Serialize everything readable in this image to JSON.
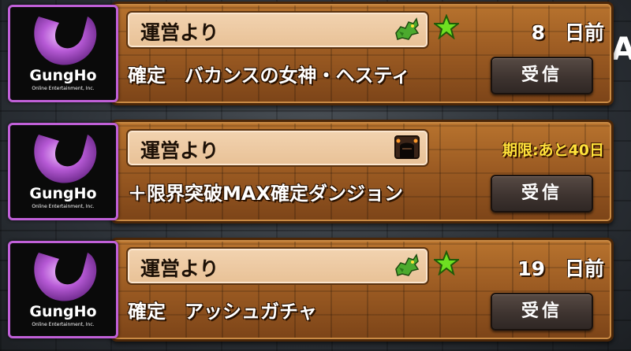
{
  "side_glyph": "A",
  "sender_logo": {
    "name": "GungHo",
    "subtitle": "Online Entertainment, Inc."
  },
  "mails": [
    {
      "sender": "運営より",
      "type_icon": "dragon-icon",
      "starred": true,
      "date_text": "8　日前",
      "deadline_text": "",
      "title": "確定　バカンスの女神・ヘスティ",
      "button_label": "受信"
    },
    {
      "sender": "運営より",
      "type_icon": "dungeon-gate-icon",
      "starred": false,
      "date_text": "",
      "deadline_text": "期限:あと40日",
      "title": "＋限界突破MAX確定ダンジョン",
      "button_label": "受信"
    },
    {
      "sender": "運営より",
      "type_icon": "dragon-icon",
      "starred": true,
      "date_text": "19　日前",
      "deadline_text": "",
      "title": "確定　アッシュガチャ",
      "button_label": "受信"
    }
  ],
  "colors": {
    "frame": "#9a5a22",
    "logo_border": "#c060d8",
    "deadline": "#ffe23a",
    "star": "#6ee021"
  }
}
